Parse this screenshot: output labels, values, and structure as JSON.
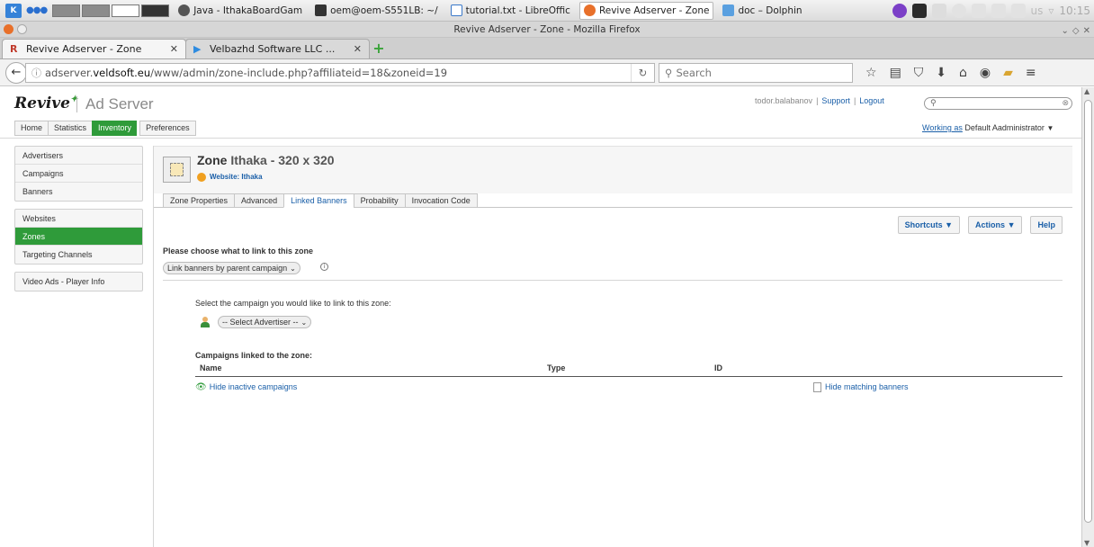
{
  "taskbar": {
    "tasks": [
      {
        "label": "Java - IthakaBoardGam",
        "color": "#555555"
      },
      {
        "label": "oem@oem-S551LB: ~/",
        "color": "#333333"
      },
      {
        "label": "tutorial.txt - LibreOffic",
        "color": "#3a78c9"
      },
      {
        "label": "Revive Adserver - Zone",
        "color": "#e8702a"
      },
      {
        "label": "doc – Dolphin",
        "color": "#5aa0e0"
      }
    ],
    "lang": "us",
    "clock": "10:15"
  },
  "window": {
    "title": "Revive Adserver - Zone - Mozilla Firefox"
  },
  "browser_tabs": [
    {
      "label": "Revive Adserver - Zone",
      "fav": "R",
      "fav_color": "#c03a2b"
    },
    {
      "label": "Velbazhd Software LLC ...",
      "fav": "▶",
      "fav_color": "#2e8be0"
    }
  ],
  "address": {
    "prefix": "adserver.",
    "domain": "veldsoft.eu",
    "path": "/www/admin/zone-include.php?affiliateid=18&zoneid=19",
    "search_placeholder": "Search"
  },
  "header": {
    "logo": "Revive",
    "product": "Ad Server",
    "user": "todor.balabanov",
    "support": "Support",
    "logout": "Logout",
    "working_as_label": "Working as",
    "working_as_value": "Default Aadministrator"
  },
  "mainnav": [
    "Home",
    "Statistics",
    "Inventory",
    "Preferences"
  ],
  "sidebar": {
    "group1": [
      "Advertisers",
      "Campaigns",
      "Banners"
    ],
    "group2": [
      "Websites",
      "Zones",
      "Targeting Channels"
    ],
    "group3": [
      "Video Ads - Player Info"
    ]
  },
  "zone": {
    "prefix": "Zone",
    "name": "Ithaka - 320 x 320",
    "website": "Website: Ithaka"
  },
  "tabs": [
    "Zone Properties",
    "Advanced",
    "Linked Banners",
    "Probability",
    "Invocation Code"
  ],
  "buttons": {
    "shortcuts": "Shortcuts",
    "actions": "Actions",
    "help": "Help"
  },
  "form": {
    "choose_label": "Please choose what to link to this zone",
    "link_mode": "Link banners by parent campaign",
    "select_campaign_label": "Select the campaign you would like to link to this zone:",
    "advertiser_select": "-- Select Advertiser --"
  },
  "linked": {
    "title": "Campaigns linked to the zone:",
    "col_name": "Name",
    "col_type": "Type",
    "col_id": "ID",
    "hide_inactive": "Hide inactive campaigns",
    "hide_matching": "Hide matching banners"
  },
  "colors": {
    "accent": "#2f9b3a",
    "link": "#1a5fa8"
  }
}
